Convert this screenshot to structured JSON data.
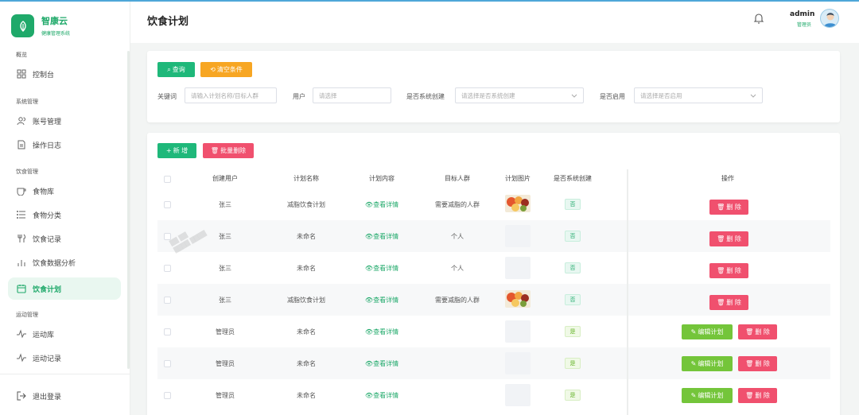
{
  "colors": {
    "brand": "#1fa96a",
    "query": "#1fb87a",
    "clear": "#f7a623",
    "danger": "#f0506e",
    "edit": "#74c53a"
  },
  "brand": {
    "name": "智康云",
    "subtitle": "健康管理系统"
  },
  "sidebar": {
    "groups": [
      {
        "label": "概览",
        "items": [
          {
            "label": "控制台",
            "icon": "grid-icon"
          }
        ]
      },
      {
        "label": "系统管理",
        "items": [
          {
            "label": "账号管理",
            "icon": "users-icon"
          },
          {
            "label": "操作日志",
            "icon": "document-icon"
          }
        ]
      },
      {
        "label": "饮食管理",
        "items": [
          {
            "label": "食物库",
            "icon": "cup-icon"
          },
          {
            "label": "食物分类",
            "icon": "list-icon"
          },
          {
            "label": "饮食记录",
            "icon": "fork-knife-icon"
          },
          {
            "label": "饮食数据分析",
            "icon": "bar-chart-icon"
          },
          {
            "label": "饮食计划",
            "icon": "calendar-icon",
            "active": true
          }
        ]
      },
      {
        "label": "运动管理",
        "items": [
          {
            "label": "运动库",
            "icon": "pulse-icon"
          },
          {
            "label": "运动记录",
            "icon": "pulse-icon"
          }
        ]
      }
    ],
    "logout": "退出登录"
  },
  "header": {
    "title": "饮食计划",
    "user": "admin",
    "role": "管理员"
  },
  "filter": {
    "query_btn": "查询",
    "clear_btn": "清空条件",
    "keyword_label": "关键词",
    "keyword_placeholder": "请输入计划名称/目标人群",
    "user_label": "用户",
    "user_placeholder": "请选择",
    "system_label": "是否系统创建",
    "system_placeholder": "请选择是否系统创建",
    "enabled_label": "是否启用",
    "enabled_placeholder": "请选择是否启用"
  },
  "actions": {
    "add": "新 增",
    "batch_delete": "批量删除",
    "edit": "编辑计划",
    "delete": "删 除"
  },
  "table": {
    "headers": [
      "创建用户",
      "计划名称",
      "计划内容",
      "目标人群",
      "计划图片",
      "是否系统创建",
      "操作"
    ],
    "rows": [
      {
        "user": "张三",
        "name": "减脂饮食计划",
        "content": "查看详情",
        "target": "需要减脂的人群",
        "image": "food",
        "system": "否",
        "editable": false
      },
      {
        "user": "张三",
        "name": "未命名",
        "content": "查看详情",
        "target": "个人",
        "image": "none",
        "system": "否",
        "editable": false
      },
      {
        "user": "张三",
        "name": "未命名",
        "content": "查看详情",
        "target": "个人",
        "image": "none",
        "system": "否",
        "editable": false
      },
      {
        "user": "张三",
        "name": "减脂饮食计划",
        "content": "查看详情",
        "target": "需要减脂的人群",
        "image": "food",
        "system": "否",
        "editable": false
      },
      {
        "user": "管理员",
        "name": "未命名",
        "content": "查看详情",
        "target": "",
        "image": "none",
        "system": "是",
        "editable": true
      },
      {
        "user": "管理员",
        "name": "未命名",
        "content": "查看详情",
        "target": "",
        "image": "none",
        "system": "是",
        "editable": true
      },
      {
        "user": "管理员",
        "name": "未命名",
        "content": "查看详情",
        "target": "",
        "image": "none",
        "system": "是",
        "editable": true
      }
    ]
  }
}
